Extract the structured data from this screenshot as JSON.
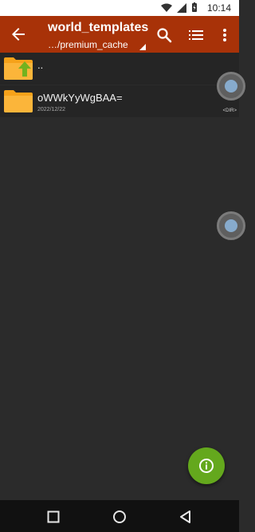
{
  "status": {
    "time": "10:14"
  },
  "appbar": {
    "title": "world_templates",
    "path": "…/premium_cache"
  },
  "files": [
    {
      "name": "..",
      "date": ""
    },
    {
      "name": "oWWkYyWgBAA=",
      "date": "2022/12/22"
    }
  ],
  "side": {
    "dir_label": "<DIR>"
  },
  "colors": {
    "appbar": "#a83208",
    "fab": "#64a81d",
    "background": "#2b2b2b"
  },
  "icons": [
    "back-icon",
    "search-icon",
    "list-view-icon",
    "more-vert-icon",
    "folder-up-icon",
    "folder-icon",
    "info-icon"
  ]
}
